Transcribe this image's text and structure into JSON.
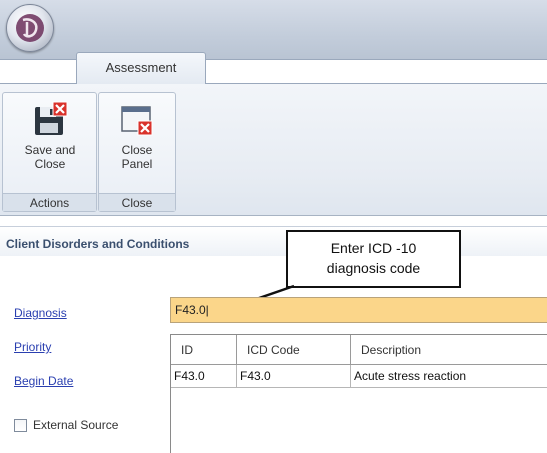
{
  "ribbon": {
    "tab_label": "Assessment",
    "groups": [
      {
        "label": "Actions",
        "button": {
          "line1": "Save and",
          "line2": "Close",
          "icon": "save-close-icon"
        }
      },
      {
        "label": "Close",
        "button": {
          "line1": "Close",
          "line2": "Panel",
          "icon": "close-panel-icon"
        }
      }
    ]
  },
  "section": {
    "title": "Client Disorders and Conditions"
  },
  "callout": {
    "line1": "Enter ICD -10",
    "line2": "diagnosis code"
  },
  "form": {
    "diagnosis_label": "Diagnosis",
    "diagnosis_value": "F43.0|",
    "priority_label": "Priority",
    "begin_date_label": "Begin Date",
    "external_source_label": "External Source",
    "external_source_checked": false
  },
  "table": {
    "columns": [
      "ID",
      "ICD Code",
      "Description"
    ],
    "rows": [
      [
        "F43.0",
        "F43.0",
        "Acute stress reaction"
      ]
    ]
  },
  "colors": {
    "diagnosis_field_bg": "#fbd68a",
    "link_blue": "#2a3fb0",
    "section_title": "#3a4f6e"
  }
}
